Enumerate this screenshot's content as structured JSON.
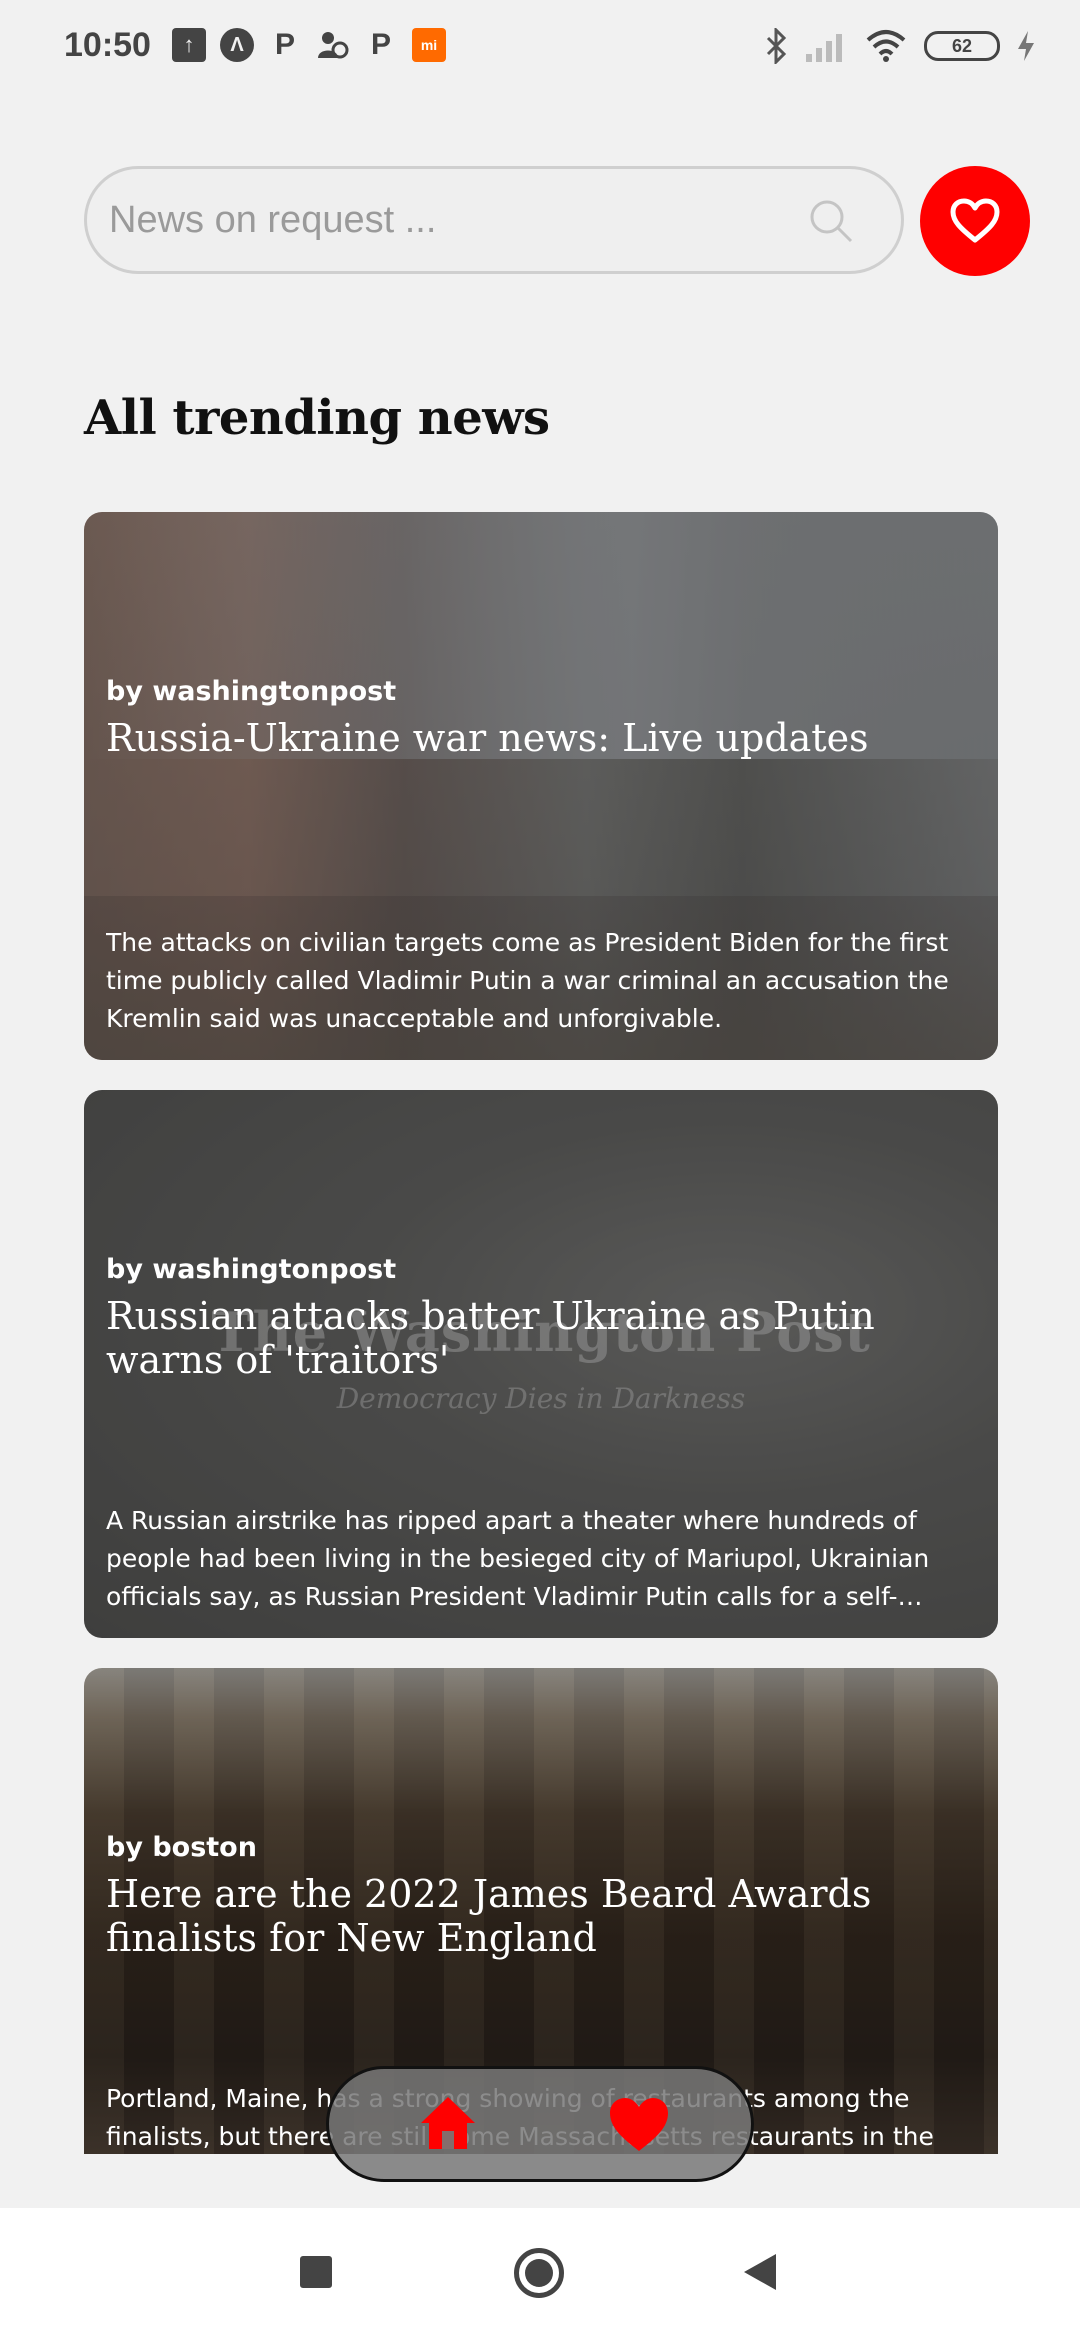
{
  "status_bar": {
    "time": "10:50",
    "notification_icons": [
      "upload-icon",
      "nav-a-icon",
      "p-icon",
      "people-icon",
      "p-icon",
      "mi-icon"
    ],
    "battery_level": "62"
  },
  "search": {
    "placeholder": "News on request ..."
  },
  "section_title": "All trending news",
  "articles": [
    {
      "source": "by washingtonpost",
      "title": "Russia-Ukraine war news: Live updates",
      "description": "The attacks on civilian targets come as President Biden for the first time publicly called Vladimir Putin a war criminal  an accusation the Kremlin said was unacceptable and unforgivable."
    },
    {
      "source": "by washingtonpost",
      "title": "Russian attacks batter Ukraine as Putin warns of 'traitors'",
      "description": "A Russian airstrike has ripped apart a theater where hundreds of people had been living in the besieged city of Mariupol, Ukrainian officials say, as Russian President Vladimir Putin calls for a self-purification of society",
      "image_logo": "The Washington Post",
      "image_tagline": "Democracy Dies in Darkness"
    },
    {
      "source": "by boston",
      "title": "Here are the 2022 James Beard Awards finalists for New England",
      "description": "Portland, Maine, has a strong showing of restaurants among the finalists, but there are still some Massachusetts restaurants in the"
    }
  ],
  "colors": {
    "accent": "#ff0000",
    "background": "#f1f1f1"
  },
  "bottom_nav": {
    "items": [
      "home-icon",
      "heart-icon"
    ]
  }
}
